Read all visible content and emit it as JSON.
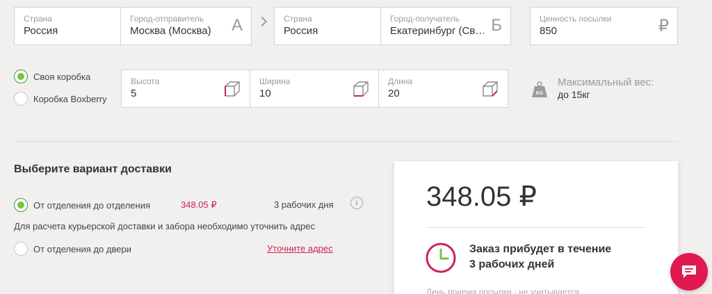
{
  "route": {
    "from": {
      "country_label": "Страна",
      "country_value": "Россия",
      "city_label": "Город-отправитель",
      "city_value": "Москва (Москва)",
      "letter": "А"
    },
    "to": {
      "country_label": "Страна",
      "country_value": "Россия",
      "city_label": "Город-получатель",
      "city_value": "Екатеринбург (Св…",
      "letter": "Б"
    },
    "value": {
      "label": "Ценность посылки",
      "amount": "850",
      "currency": "₽"
    }
  },
  "box_options": [
    {
      "label": "Своя коробка",
      "selected": true
    },
    {
      "label": "Коробка Boxberry",
      "selected": false
    }
  ],
  "dimensions": [
    {
      "label": "Высота",
      "value": "5",
      "icon": "box-height-icon"
    },
    {
      "label": "Ширина",
      "value": "10",
      "icon": "box-width-icon"
    },
    {
      "label": "Длина",
      "value": "20",
      "icon": "box-length-icon"
    }
  ],
  "max_weight": {
    "label": "Максимальный вес:",
    "value": "до 15кг",
    "icon": "kg-weight-icon"
  },
  "delivery": {
    "title": "Выберите вариант доставки",
    "options": [
      {
        "label": "От отделения до отделения",
        "price": "348.05 ₽",
        "days": "3 рабочих дня",
        "selected": true
      },
      {
        "label": "От отделения до двери",
        "link": "Уточните адрес",
        "selected": false
      }
    ],
    "note": "Для расчета курьерской доставки и забора необходимо уточнить адрес"
  },
  "summary": {
    "price": "348.05 ₽",
    "arrival_line1": "Заказ прибудет в течение",
    "arrival_line2": "3 рабочих дней",
    "footnote": "День приема посылки - не учитывается"
  },
  "colors": {
    "accent": "#cc2255",
    "radio_selected": "#7cc23f",
    "chat": "#e0194e",
    "clock": "#cc2255"
  }
}
